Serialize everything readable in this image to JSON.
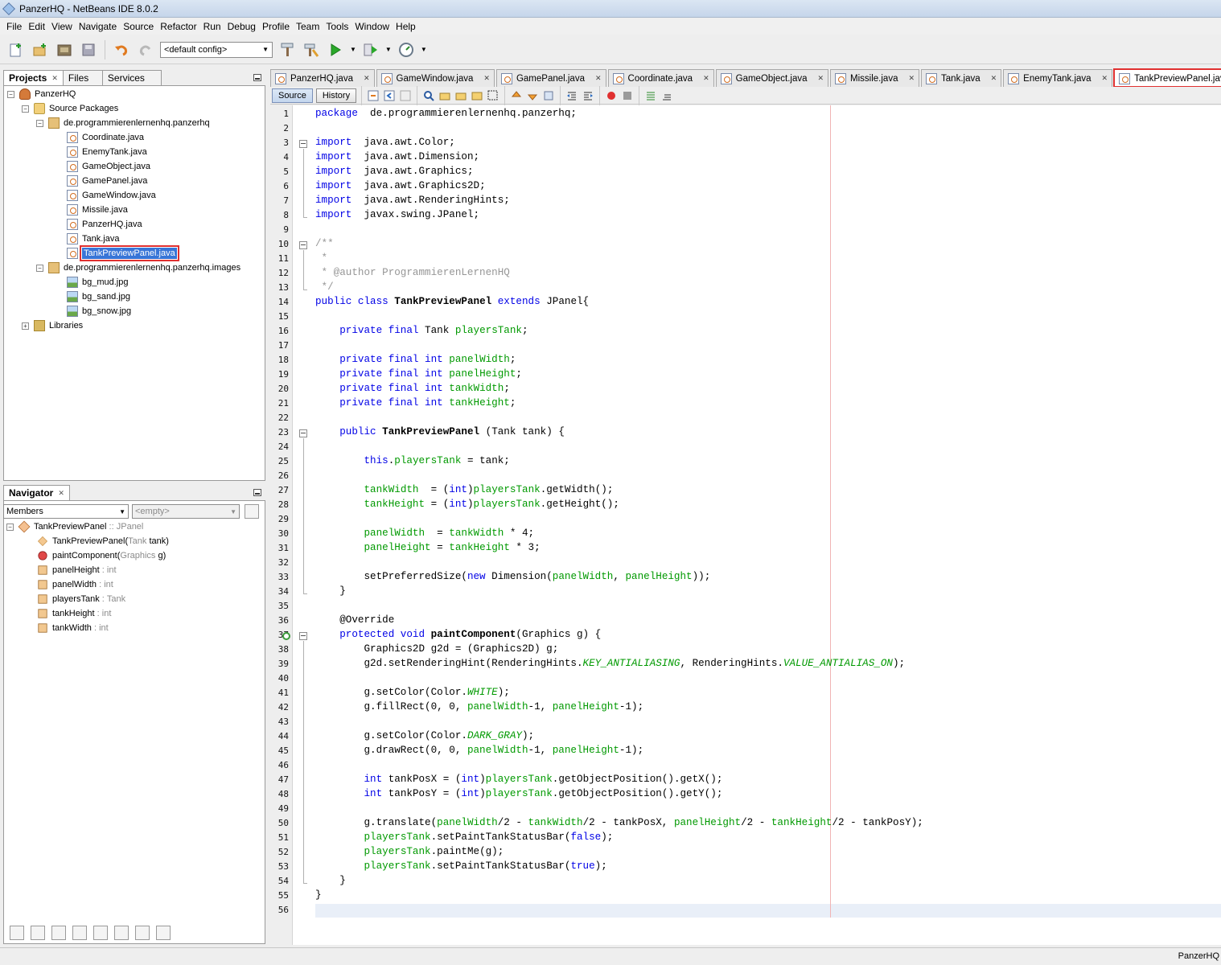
{
  "window": {
    "title": "PanzerHQ - NetBeans IDE 8.0.2"
  },
  "menu": [
    "File",
    "Edit",
    "View",
    "Navigate",
    "Source",
    "Refactor",
    "Run",
    "Debug",
    "Profile",
    "Team",
    "Tools",
    "Window",
    "Help"
  ],
  "toolbar": {
    "config": "<default config>"
  },
  "projects_panel": {
    "tabs": [
      "Projects",
      "Files",
      "Services"
    ],
    "tree": {
      "project": "PanzerHQ",
      "source_packages": "Source Packages",
      "package1": "de.programmierenlernenhq.panzerhq",
      "files": [
        "Coordinate.java",
        "EnemyTank.java",
        "GameObject.java",
        "GamePanel.java",
        "GameWindow.java",
        "Missile.java",
        "PanzerHQ.java",
        "Tank.java",
        "TankPreviewPanel.java"
      ],
      "package2": "de.programmierenlernenhq.panzerhq.images",
      "images": [
        "bg_mud.jpg",
        "bg_sand.jpg",
        "bg_snow.jpg"
      ],
      "libraries": "Libraries"
    }
  },
  "navigator": {
    "title": "Navigator",
    "filter": "Members",
    "empty": "<empty>",
    "class_name": "TankPreviewPanel",
    "class_sep": " :: ",
    "class_super": "JPanel",
    "members": [
      {
        "name": "TankPreviewPanel(",
        "type": "Tank",
        "suffix": " tank)",
        "icon": "constructor-icon"
      },
      {
        "name": "paintComponent(",
        "type": "Graphics",
        "suffix": " g)",
        "icon": "method-icon"
      },
      {
        "name": "panelHeight",
        "sep": " : ",
        "type": "int",
        "icon": "field-icon"
      },
      {
        "name": "panelWidth",
        "sep": " : ",
        "type": "int",
        "icon": "field-icon"
      },
      {
        "name": "playersTank",
        "sep": " : ",
        "type": "Tank",
        "icon": "field-icon"
      },
      {
        "name": "tankHeight",
        "sep": " : ",
        "type": "int",
        "icon": "field-icon"
      },
      {
        "name": "tankWidth",
        "sep": " : ",
        "type": "int",
        "icon": "field-icon"
      }
    ]
  },
  "editor_tabs": [
    "PanzerHQ.java",
    "GameWindow.java",
    "GamePanel.java",
    "Coordinate.java",
    "GameObject.java",
    "Missile.java",
    "Tank.java",
    "EnemyTank.java",
    "TankPreviewPanel.java"
  ],
  "editor_toolbar": {
    "source": "Source",
    "history": "History"
  },
  "code_lines": [
    [
      [
        "kw",
        "package"
      ],
      [
        "",
        "  de.programmierenlernenhq.panzerhq;"
      ]
    ],
    [],
    [
      [
        "kw",
        "import"
      ],
      [
        "",
        "  java.awt.Color;"
      ]
    ],
    [
      [
        "kw",
        "import"
      ],
      [
        "",
        "  java.awt.Dimension;"
      ]
    ],
    [
      [
        "kw",
        "import"
      ],
      [
        "",
        "  java.awt.Graphics;"
      ]
    ],
    [
      [
        "kw",
        "import"
      ],
      [
        "",
        "  java.awt.Graphics2D;"
      ]
    ],
    [
      [
        "kw",
        "import"
      ],
      [
        "",
        "  java.awt.RenderingHints;"
      ]
    ],
    [
      [
        "kw",
        "import"
      ],
      [
        "",
        "  javax.swing.JPanel;"
      ]
    ],
    [],
    [
      [
        "cm",
        "/**"
      ]
    ],
    [
      [
        "cm",
        " *"
      ]
    ],
    [
      [
        "cm",
        " * @author ProgrammierenLernenHQ"
      ]
    ],
    [
      [
        "cm",
        " */"
      ]
    ],
    [
      [
        "kw",
        "public class"
      ],
      [
        "",
        " "
      ],
      [
        "b",
        "TankPreviewPanel"
      ],
      [
        "",
        " "
      ],
      [
        "kw",
        "extends"
      ],
      [
        "",
        " JPanel{"
      ]
    ],
    [],
    [
      [
        "",
        "    "
      ],
      [
        "kw",
        "private final"
      ],
      [
        "",
        " Tank "
      ],
      [
        "fl",
        "playersTank"
      ],
      [
        "",
        ";"
      ]
    ],
    [],
    [
      [
        "",
        "    "
      ],
      [
        "kw",
        "private final int"
      ],
      [
        "",
        " "
      ],
      [
        "fl",
        "panelWidth"
      ],
      [
        "",
        ";"
      ]
    ],
    [
      [
        "",
        "    "
      ],
      [
        "kw",
        "private final int"
      ],
      [
        "",
        " "
      ],
      [
        "fl",
        "panelHeight"
      ],
      [
        "",
        ";"
      ]
    ],
    [
      [
        "",
        "    "
      ],
      [
        "kw",
        "private final int"
      ],
      [
        "",
        " "
      ],
      [
        "fl",
        "tankWidth"
      ],
      [
        "",
        ";"
      ]
    ],
    [
      [
        "",
        "    "
      ],
      [
        "kw",
        "private final int"
      ],
      [
        "",
        " "
      ],
      [
        "fl",
        "tankHeight"
      ],
      [
        "",
        ";"
      ]
    ],
    [],
    [
      [
        "",
        "    "
      ],
      [
        "kw",
        "public"
      ],
      [
        "",
        " "
      ],
      [
        "b",
        "TankPreviewPanel"
      ],
      [
        "",
        " (Tank tank) {"
      ]
    ],
    [],
    [
      [
        "",
        "        "
      ],
      [
        "kw",
        "this"
      ],
      [
        "",
        "."
      ],
      [
        "fl",
        "playersTank"
      ],
      [
        "",
        " = tank;"
      ]
    ],
    [],
    [
      [
        "",
        "        "
      ],
      [
        "fl",
        "tankWidth"
      ],
      [
        "",
        "  = ("
      ],
      [
        "kw",
        "int"
      ],
      [
        "",
        ")"
      ],
      [
        "fl",
        "playersTank"
      ],
      [
        "",
        ".getWidth();"
      ]
    ],
    [
      [
        "",
        "        "
      ],
      [
        "fl",
        "tankHeight"
      ],
      [
        "",
        " = ("
      ],
      [
        "kw",
        "int"
      ],
      [
        "",
        ")"
      ],
      [
        "fl",
        "playersTank"
      ],
      [
        "",
        ".getHeight();"
      ]
    ],
    [],
    [
      [
        "",
        "        "
      ],
      [
        "fl",
        "panelWidth"
      ],
      [
        "",
        "  = "
      ],
      [
        "fl",
        "tankWidth"
      ],
      [
        "",
        " * 4;"
      ]
    ],
    [
      [
        "",
        "        "
      ],
      [
        "fl",
        "panelHeight"
      ],
      [
        "",
        " = "
      ],
      [
        "fl",
        "tankHeight"
      ],
      [
        "",
        " * 3;"
      ]
    ],
    [],
    [
      [
        "",
        "        setPreferredSize("
      ],
      [
        "kw",
        "new"
      ],
      [
        "",
        " Dimension("
      ],
      [
        "fl",
        "panelWidth"
      ],
      [
        "",
        ", "
      ],
      [
        "fl",
        "panelHeight"
      ],
      [
        "",
        "));"
      ]
    ],
    [
      [
        "",
        "    }"
      ]
    ],
    [],
    [
      [
        "",
        "    @Override"
      ]
    ],
    [
      [
        "",
        "    "
      ],
      [
        "kw",
        "protected void"
      ],
      [
        "",
        " "
      ],
      [
        "b",
        "paintComponent"
      ],
      [
        "",
        "(Graphics g) {"
      ]
    ],
    [
      [
        "",
        "        Graphics2D g2d = (Graphics2D) g;"
      ]
    ],
    [
      [
        "",
        "        g2d.setRenderingHint(RenderingHints."
      ],
      [
        "st",
        "KEY_ANTIALIASING"
      ],
      [
        "",
        ", RenderingHints."
      ],
      [
        "st",
        "VALUE_ANTIALIAS_ON"
      ],
      [
        "",
        ");"
      ]
    ],
    [],
    [
      [
        "",
        "        g.setColor(Color."
      ],
      [
        "st",
        "WHITE"
      ],
      [
        "",
        ");"
      ]
    ],
    [
      [
        "",
        "        g.fillRect(0, 0, "
      ],
      [
        "fl",
        "panelWidth"
      ],
      [
        "",
        "-1, "
      ],
      [
        "fl",
        "panelHeight"
      ],
      [
        "",
        "-1);"
      ]
    ],
    [],
    [
      [
        "",
        "        g.setColor(Color."
      ],
      [
        "st",
        "DARK_GRAY"
      ],
      [
        "",
        ");"
      ]
    ],
    [
      [
        "",
        "        g.drawRect(0, 0, "
      ],
      [
        "fl",
        "panelWidth"
      ],
      [
        "",
        "-1, "
      ],
      [
        "fl",
        "panelHeight"
      ],
      [
        "",
        "-1);"
      ]
    ],
    [],
    [
      [
        "",
        "        "
      ],
      [
        "kw",
        "int"
      ],
      [
        "",
        " tankPosX = ("
      ],
      [
        "kw",
        "int"
      ],
      [
        "",
        ")"
      ],
      [
        "fl",
        "playersTank"
      ],
      [
        "",
        ".getObjectPosition().getX();"
      ]
    ],
    [
      [
        "",
        "        "
      ],
      [
        "kw",
        "int"
      ],
      [
        "",
        " tankPosY = ("
      ],
      [
        "kw",
        "int"
      ],
      [
        "",
        ")"
      ],
      [
        "fl",
        "playersTank"
      ],
      [
        "",
        ".getObjectPosition().getY();"
      ]
    ],
    [],
    [
      [
        "",
        "        g.translate("
      ],
      [
        "fl",
        "panelWidth"
      ],
      [
        "",
        "/2 - "
      ],
      [
        "fl",
        "tankWidth"
      ],
      [
        "",
        "/2 - tankPosX, "
      ],
      [
        "fl",
        "panelHeight"
      ],
      [
        "",
        "/2 - "
      ],
      [
        "fl",
        "tankHeight"
      ],
      [
        "",
        "/2 - tankPosY);"
      ]
    ],
    [
      [
        "",
        "        "
      ],
      [
        "fl",
        "playersTank"
      ],
      [
        "",
        ".setPaintTankStatusBar("
      ],
      [
        "kw",
        "false"
      ],
      [
        "",
        ");"
      ]
    ],
    [
      [
        "",
        "        "
      ],
      [
        "fl",
        "playersTank"
      ],
      [
        "",
        ".paintMe(g);"
      ]
    ],
    [
      [
        "",
        "        "
      ],
      [
        "fl",
        "playersTank"
      ],
      [
        "",
        ".setPaintTankStatusBar("
      ],
      [
        "kw",
        "true"
      ],
      [
        "",
        ");"
      ]
    ],
    [
      [
        "",
        "    }"
      ]
    ],
    [
      [
        "",
        "}"
      ]
    ],
    []
  ],
  "status": {
    "project": "PanzerHQ"
  }
}
